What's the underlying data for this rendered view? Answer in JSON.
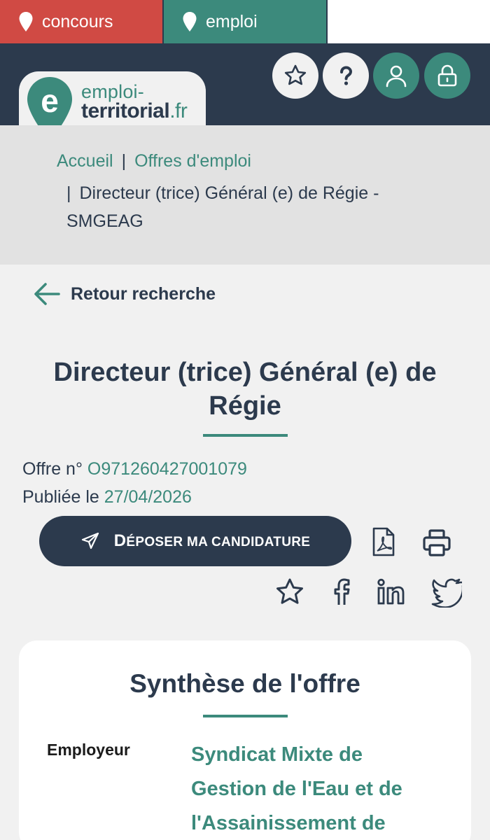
{
  "tabs": [
    {
      "label": "concours",
      "color": "#d04a44"
    },
    {
      "label": "emploi",
      "color": "#3c8a7c"
    }
  ],
  "logo": {
    "line1": "emploi-",
    "line2_main": "territorial",
    "line2_suffix": ".fr",
    "letter": "e"
  },
  "header_icons": [
    "star-icon",
    "question-icon",
    "user-icon",
    "lock-icon"
  ],
  "breadcrumb": {
    "home": "Accueil",
    "offers": "Offres d'emploi",
    "current": "Directeur (trice) Général (e) de Régie - SMGEAG"
  },
  "back_label": "Retour recherche",
  "offer": {
    "title": "Directeur (trice) Général (e) de Régie",
    "number_label": "Offre n°",
    "number": "O971260427001079",
    "published_label": "Publiée le",
    "published_date": "27/04/2026"
  },
  "actions": {
    "apply_label": "Déposer ma candidature",
    "icons": [
      "pdf-icon",
      "print-icon",
      "favorite-star-icon",
      "facebook-icon",
      "linkedin-icon",
      "twitter-icon"
    ]
  },
  "synthese": {
    "title": "Synthèse de l'offre",
    "employer_label": "Employeur",
    "employer_value": "Syndicat Mixte de Gestion de l'Eau et de l'Assainissement de"
  },
  "colors": {
    "navy": "#2c3a4d",
    "green": "#3c8a7c",
    "red": "#d04a44",
    "background": "#f1f1f1",
    "breadcrumb_bg": "#e2e2e2"
  }
}
